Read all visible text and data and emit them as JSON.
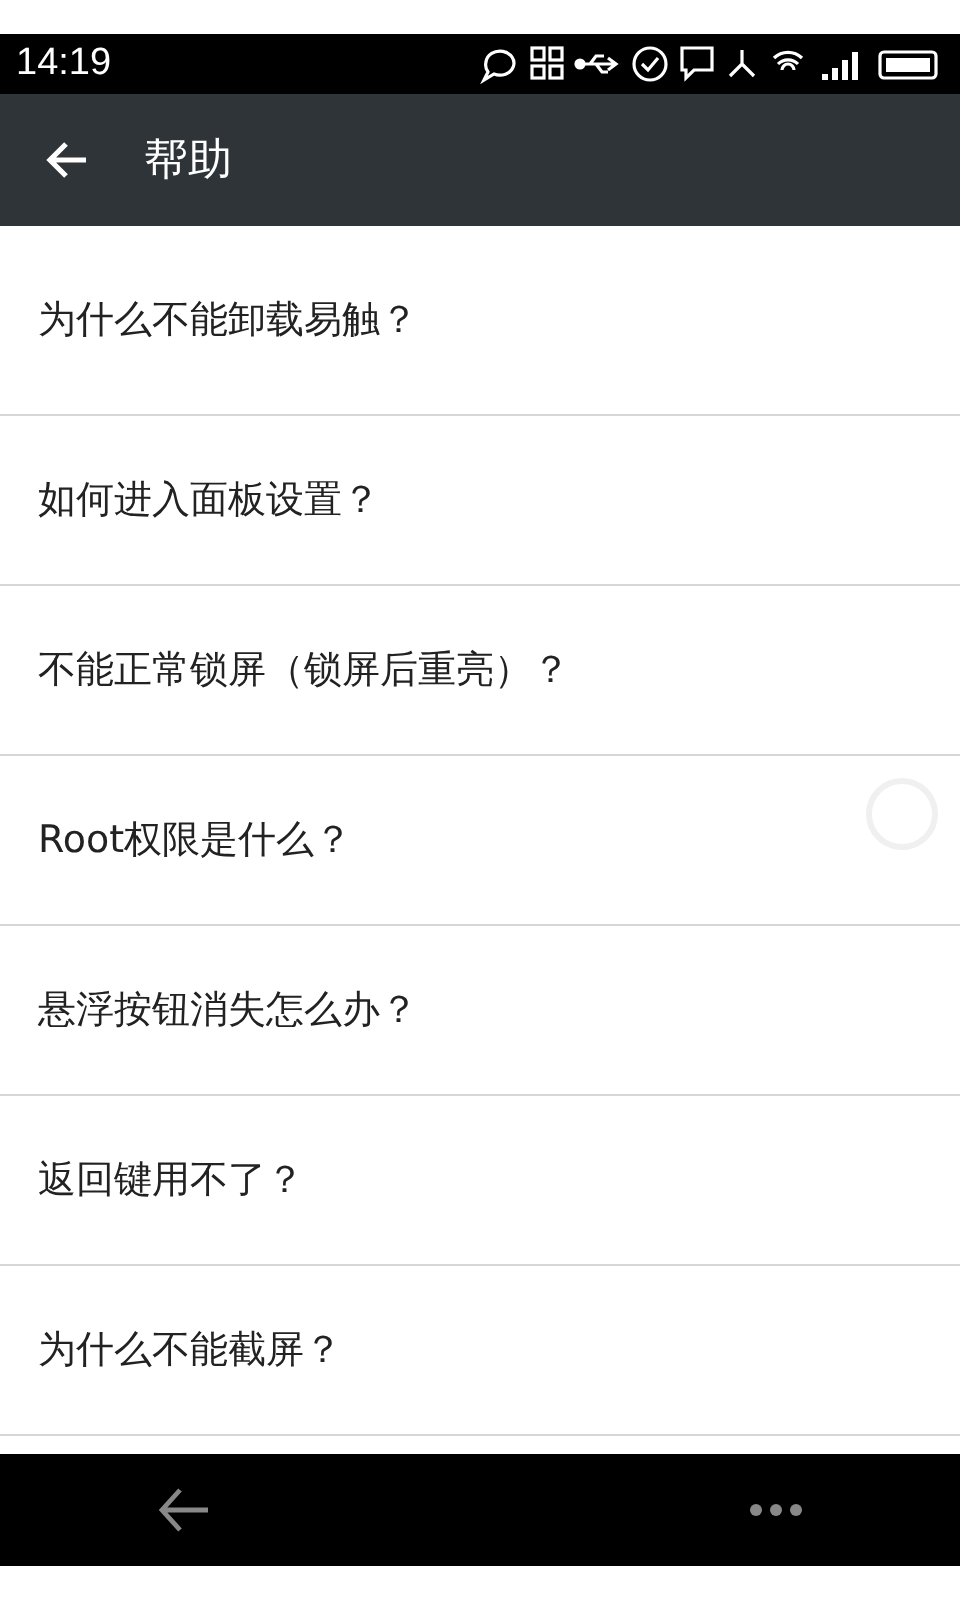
{
  "status_bar": {
    "time": "14:19"
  },
  "app_bar": {
    "title": "帮助"
  },
  "questions": [
    {
      "text": "为什么不能卸载易触？"
    },
    {
      "text": "如何进入面板设置？"
    },
    {
      "text": "不能正常锁屏（锁屏后重亮）？"
    },
    {
      "text": "Root权限是什么？"
    },
    {
      "text": "悬浮按钮消失怎么办？"
    },
    {
      "text": "返回键用不了？"
    },
    {
      "text": "为什么不能截屏？"
    }
  ]
}
